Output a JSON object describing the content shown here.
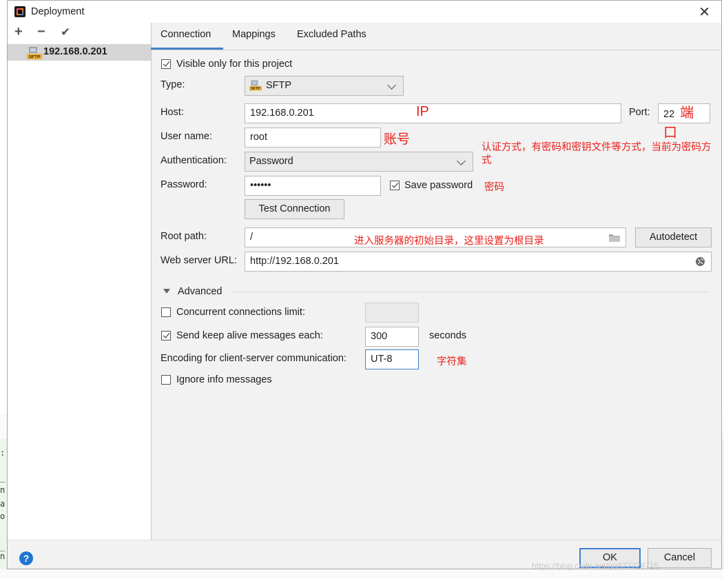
{
  "window": {
    "title": "Deployment"
  },
  "toolbar": {
    "add": "+",
    "remove": "−",
    "apply": "✔"
  },
  "servers": [
    {
      "name": "192.168.0.201",
      "icon": "sftp-icon"
    }
  ],
  "tabs": [
    {
      "label": "Connection",
      "active": true
    },
    {
      "label": "Mappings",
      "active": false
    },
    {
      "label": "Excluded Paths",
      "active": false
    }
  ],
  "form": {
    "visible_only": {
      "label": "Visible only for this project",
      "checked": true
    },
    "type": {
      "label": "Type:",
      "value": "SFTP"
    },
    "host": {
      "label": "Host:",
      "value": "192.168.0.201"
    },
    "port": {
      "label": "Port:",
      "value": "22"
    },
    "username": {
      "label": "User name:",
      "value": "root"
    },
    "auth": {
      "label": "Authentication:",
      "value": "Password"
    },
    "password": {
      "label": "Password:",
      "value": "••••••"
    },
    "save_password": {
      "label": "Save password",
      "checked": true
    },
    "test_connection": "Test Connection",
    "root_path": {
      "label": "Root path:",
      "value": "/"
    },
    "autodetect": "Autodetect",
    "web_url": {
      "label": "Web server URL:",
      "value": "http://192.168.0.201"
    }
  },
  "advanced": {
    "title": "Advanced",
    "concurrent": {
      "label": "Concurrent connections limit:",
      "checked": false,
      "value": ""
    },
    "keep_alive": {
      "label": "Send keep alive messages each:",
      "checked": true,
      "value": "300",
      "unit": "seconds"
    },
    "encoding": {
      "label": "Encoding for client-server communication:",
      "value": "UT-8"
    },
    "ignore_info": {
      "label": "Ignore info messages",
      "checked": false
    }
  },
  "annotations": {
    "ip": "IP",
    "port": "端口",
    "account": "账号",
    "auth": "认证方式，有密码和密钥文件等方式，当前为密码方式",
    "password": "密码",
    "root_path": "进入服务器的初始目录，这里设置为根目录",
    "charset": "字符集"
  },
  "footer": {
    "help": "?",
    "ok": "OK",
    "cancel": "Cancel"
  },
  "watermark": "https://blog.csdn.net/qq877728715",
  "colors": {
    "accent": "#4083c9",
    "annotation": "#e8211c",
    "selected_row": "#d5d5d5",
    "dialog_bg": "#f2f2f2"
  }
}
